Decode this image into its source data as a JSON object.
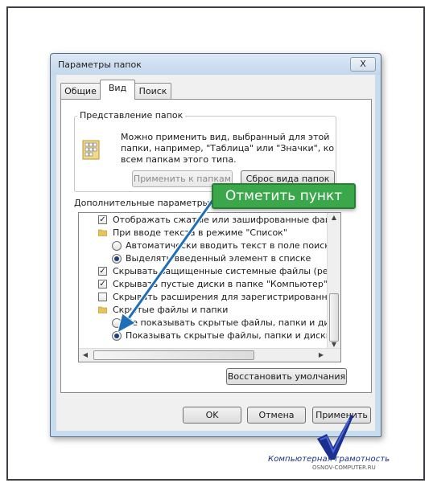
{
  "dialog": {
    "title": "Параметры папок",
    "close_label": "X"
  },
  "tabs": [
    {
      "label": "Общие",
      "active": false
    },
    {
      "label": "Вид",
      "active": true
    },
    {
      "label": "Поиск",
      "active": false
    }
  ],
  "folder_views": {
    "caption": "Представление папок",
    "description": "Можно применить вид, выбранный для этой папки, например, \"Таблица\" или \"Значки\", ко всем папкам этого типа.",
    "apply_button": "Применить к папкам",
    "reset_button": "Сброс вида папок"
  },
  "advanced": {
    "label": "Дополнительные параметры:",
    "items": [
      {
        "kind": "checkbox",
        "checked": true,
        "text": "Отображать сжатые или зашифрованные файлы NTFS"
      },
      {
        "kind": "folder",
        "text": "При вводе текста в режиме \"Список\""
      },
      {
        "kind": "radio",
        "selected": false,
        "text": "Автоматически вводить текст в поле поиска"
      },
      {
        "kind": "radio",
        "selected": true,
        "text": "Выделять введенный элемент в списке"
      },
      {
        "kind": "checkbox",
        "checked": true,
        "text": "Скрывать защищенные системные файлы (рекомендуется)"
      },
      {
        "kind": "checkbox",
        "checked": true,
        "text": "Скрывать пустые диски в папке \"Компьютер\""
      },
      {
        "kind": "checkbox",
        "checked": false,
        "text": "Скрывать расширения для зарегистрированных типов файлов"
      },
      {
        "kind": "folder",
        "text": "Скрытые файлы и папки"
      },
      {
        "kind": "radio",
        "selected": false,
        "text": "Не показывать скрытые файлы, папки и диски"
      },
      {
        "kind": "radio",
        "selected": true,
        "text": "Показывать скрытые файлы, папки и диски"
      }
    ]
  },
  "restore_button": "Восстановить умолчания",
  "footer": {
    "ok": "OK",
    "cancel": "Отмена",
    "apply": "Применить"
  },
  "annotation": {
    "callout_text": "Отметить пункт",
    "arrow_color": "#1f6fb8",
    "callout_color": "#3aa84a"
  },
  "watermark": {
    "title": "Компьютерная грамотность",
    "url": "OSNOV-COMPUTER.RU"
  }
}
